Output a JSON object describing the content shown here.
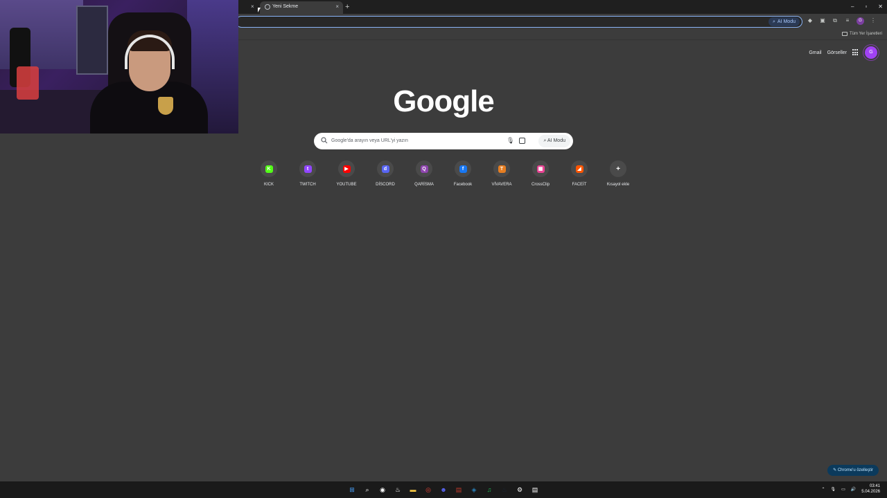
{
  "browser": {
    "tabs": [
      {
        "title": "",
        "close": "×"
      },
      {
        "title": "Yeni Sekme",
        "close": "×"
      }
    ],
    "new_tab": "+",
    "window_controls": [
      "–",
      "▫",
      "✕"
    ],
    "omnibox_ai_chip": "AI Modu",
    "bookmarks_all": "Tüm Yer İşaretleri",
    "toolbar_avatar": "G"
  },
  "ntp": {
    "links": {
      "gmail": "Gmail",
      "images": "Görseller"
    },
    "avatar": "G",
    "logo": "Google",
    "search": {
      "placeholder": "Google'da arayın veya URL'yi yazın",
      "ai_button": "AI Modu"
    },
    "shortcuts": [
      {
        "label": "KICK",
        "glyph": "K",
        "color": "#53fc18",
        "icon": "kick-icon"
      },
      {
        "label": "TWITCH",
        "glyph": "t",
        "color": "#9146ff",
        "icon": "twitch-icon"
      },
      {
        "label": "YOUTUBE",
        "glyph": "▶",
        "color": "#ff0000",
        "icon": "youtube-icon"
      },
      {
        "label": "DİSCORD",
        "glyph": "d",
        "color": "#5865f2",
        "icon": "discord-icon"
      },
      {
        "label": "QARİSMA",
        "glyph": "Q",
        "color": "#8e44ad",
        "icon": "qarisma-icon"
      },
      {
        "label": "Facebook",
        "glyph": "f",
        "color": "#1877f2",
        "icon": "facebook-icon"
      },
      {
        "label": "VİVAVERA",
        "glyph": "T",
        "color": "#e67e22",
        "icon": "vivavera-icon"
      },
      {
        "label": "CrossClip",
        "glyph": "▦",
        "color": "#e84393",
        "icon": "crossclip-icon"
      },
      {
        "label": "FACEİT",
        "glyph": "◢",
        "color": "#ff5500",
        "icon": "faceit-icon"
      },
      {
        "label": "Kısayol ekle",
        "glyph": "+",
        "color": "",
        "icon": "add-shortcut-icon"
      }
    ],
    "customize": "✎ Chrome'u özelleştir"
  },
  "taskbar": {
    "apps": [
      {
        "icon": "windows-start-icon",
        "glyph": "⊞",
        "color": "#4aa3ff"
      },
      {
        "icon": "search-icon",
        "glyph": "⌕",
        "color": ""
      },
      {
        "icon": "obs-icon",
        "glyph": "◉",
        "color": ""
      },
      {
        "icon": "steam-icon",
        "glyph": "♨",
        "color": ""
      },
      {
        "icon": "file-explorer-icon",
        "glyph": "▬",
        "color": "#f4c542"
      },
      {
        "icon": "chrome-icon",
        "glyph": "◎",
        "color": "#ea4335"
      },
      {
        "icon": "discord-icon",
        "glyph": "☻",
        "color": "#5865f2"
      },
      {
        "icon": "app-red-icon",
        "glyph": "▤",
        "color": "#c0392b"
      },
      {
        "icon": "app-blue-icon",
        "glyph": "◈",
        "color": "#2980b9"
      },
      {
        "icon": "spotify-icon",
        "glyph": "♫",
        "color": "#1db954"
      },
      {
        "icon": "steam2-icon",
        "glyph": "♨",
        "color": "#1b2838"
      },
      {
        "icon": "settings-icon",
        "glyph": "⚙",
        "color": ""
      },
      {
        "icon": "notepad-icon",
        "glyph": "▤",
        "color": ""
      }
    ],
    "time": "03:41",
    "date": "5.04.2026"
  }
}
